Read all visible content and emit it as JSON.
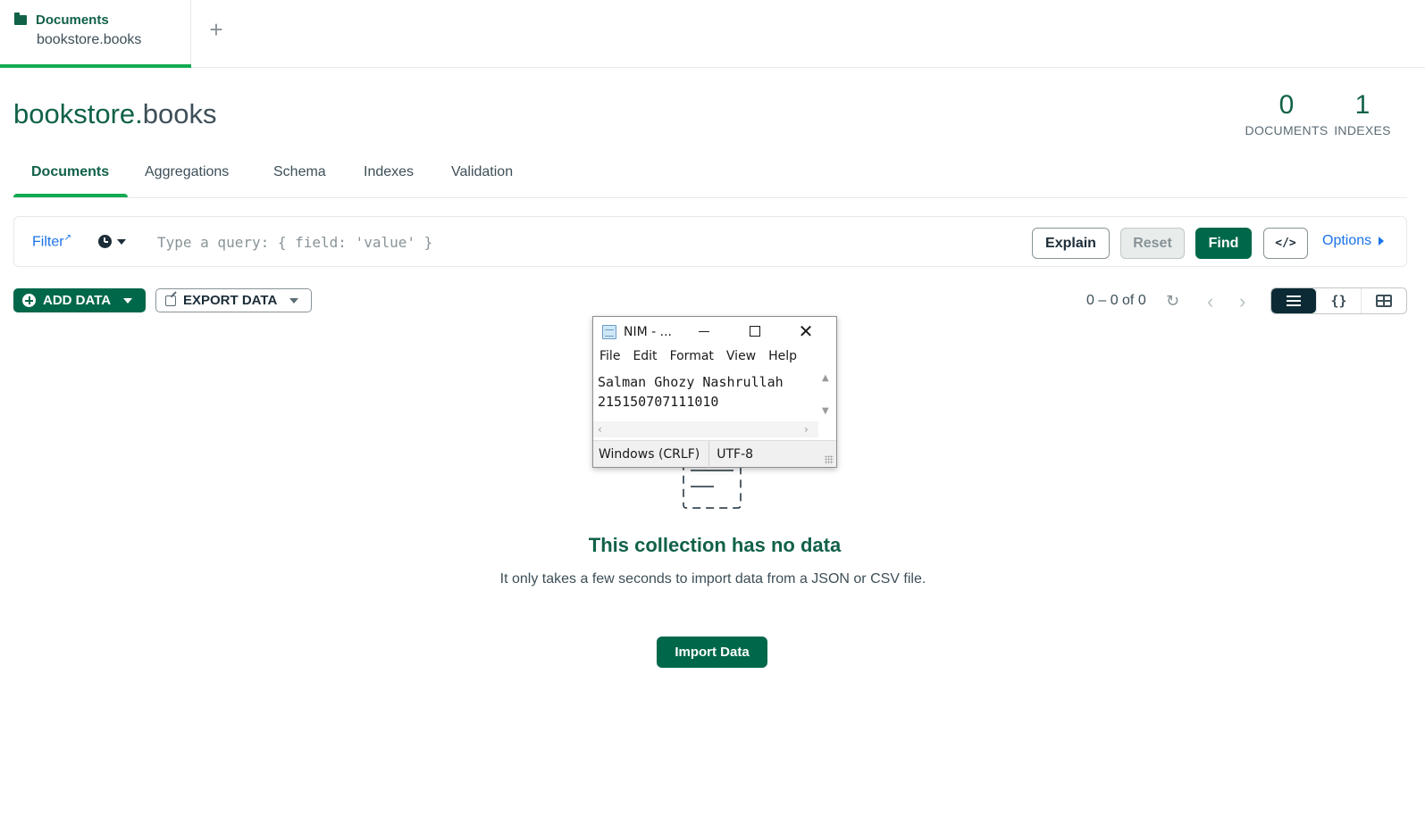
{
  "workspace_tab": {
    "title": "Documents",
    "subtitle": "bookstore.books",
    "add_tab": "+"
  },
  "header": {
    "db_name": "bookstore",
    "separator": ".",
    "collection_name": "books",
    "documents_count": "0",
    "documents_label": "DOCUMENTS",
    "indexes_count": "1",
    "indexes_label": "INDEXES"
  },
  "tabs": [
    {
      "label": "Documents",
      "active": true
    },
    {
      "label": "Aggregations"
    },
    {
      "label": "Schema"
    },
    {
      "label": "Indexes"
    },
    {
      "label": "Validation"
    }
  ],
  "query_bar": {
    "filter_label": "Filter",
    "placeholder": "Type a query: { field: 'value' }",
    "explain_label": "Explain",
    "reset_label": "Reset",
    "find_label": "Find",
    "code_label": "</>",
    "options_label": "Options"
  },
  "toolbar": {
    "add_data_label": "ADD DATA",
    "export_data_label": "EXPORT DATA",
    "pagination": "0 – 0 of 0",
    "refresh_icon": "↻",
    "prev_icon": "‹",
    "next_icon": "›",
    "json_view_icon": "{}"
  },
  "empty_state": {
    "title": "This collection has no data",
    "description": "It only takes a few seconds to import data from a JSON or CSV file.",
    "import_label": "Import Data"
  },
  "notepad": {
    "title": "NIM - ...",
    "menu": [
      "File",
      "Edit",
      "Format",
      "View",
      "Help"
    ],
    "content": "Salman Ghozy Nashrullah\n215150707111010",
    "line_ending": "Windows (CRLF)",
    "encoding": "UTF-8",
    "close_icon": "✕"
  },
  "colors": {
    "brand_green": "#00684a",
    "accent_green": "#13aa52",
    "dark_green_text": "#116149",
    "link_blue": "#1a73e8"
  }
}
